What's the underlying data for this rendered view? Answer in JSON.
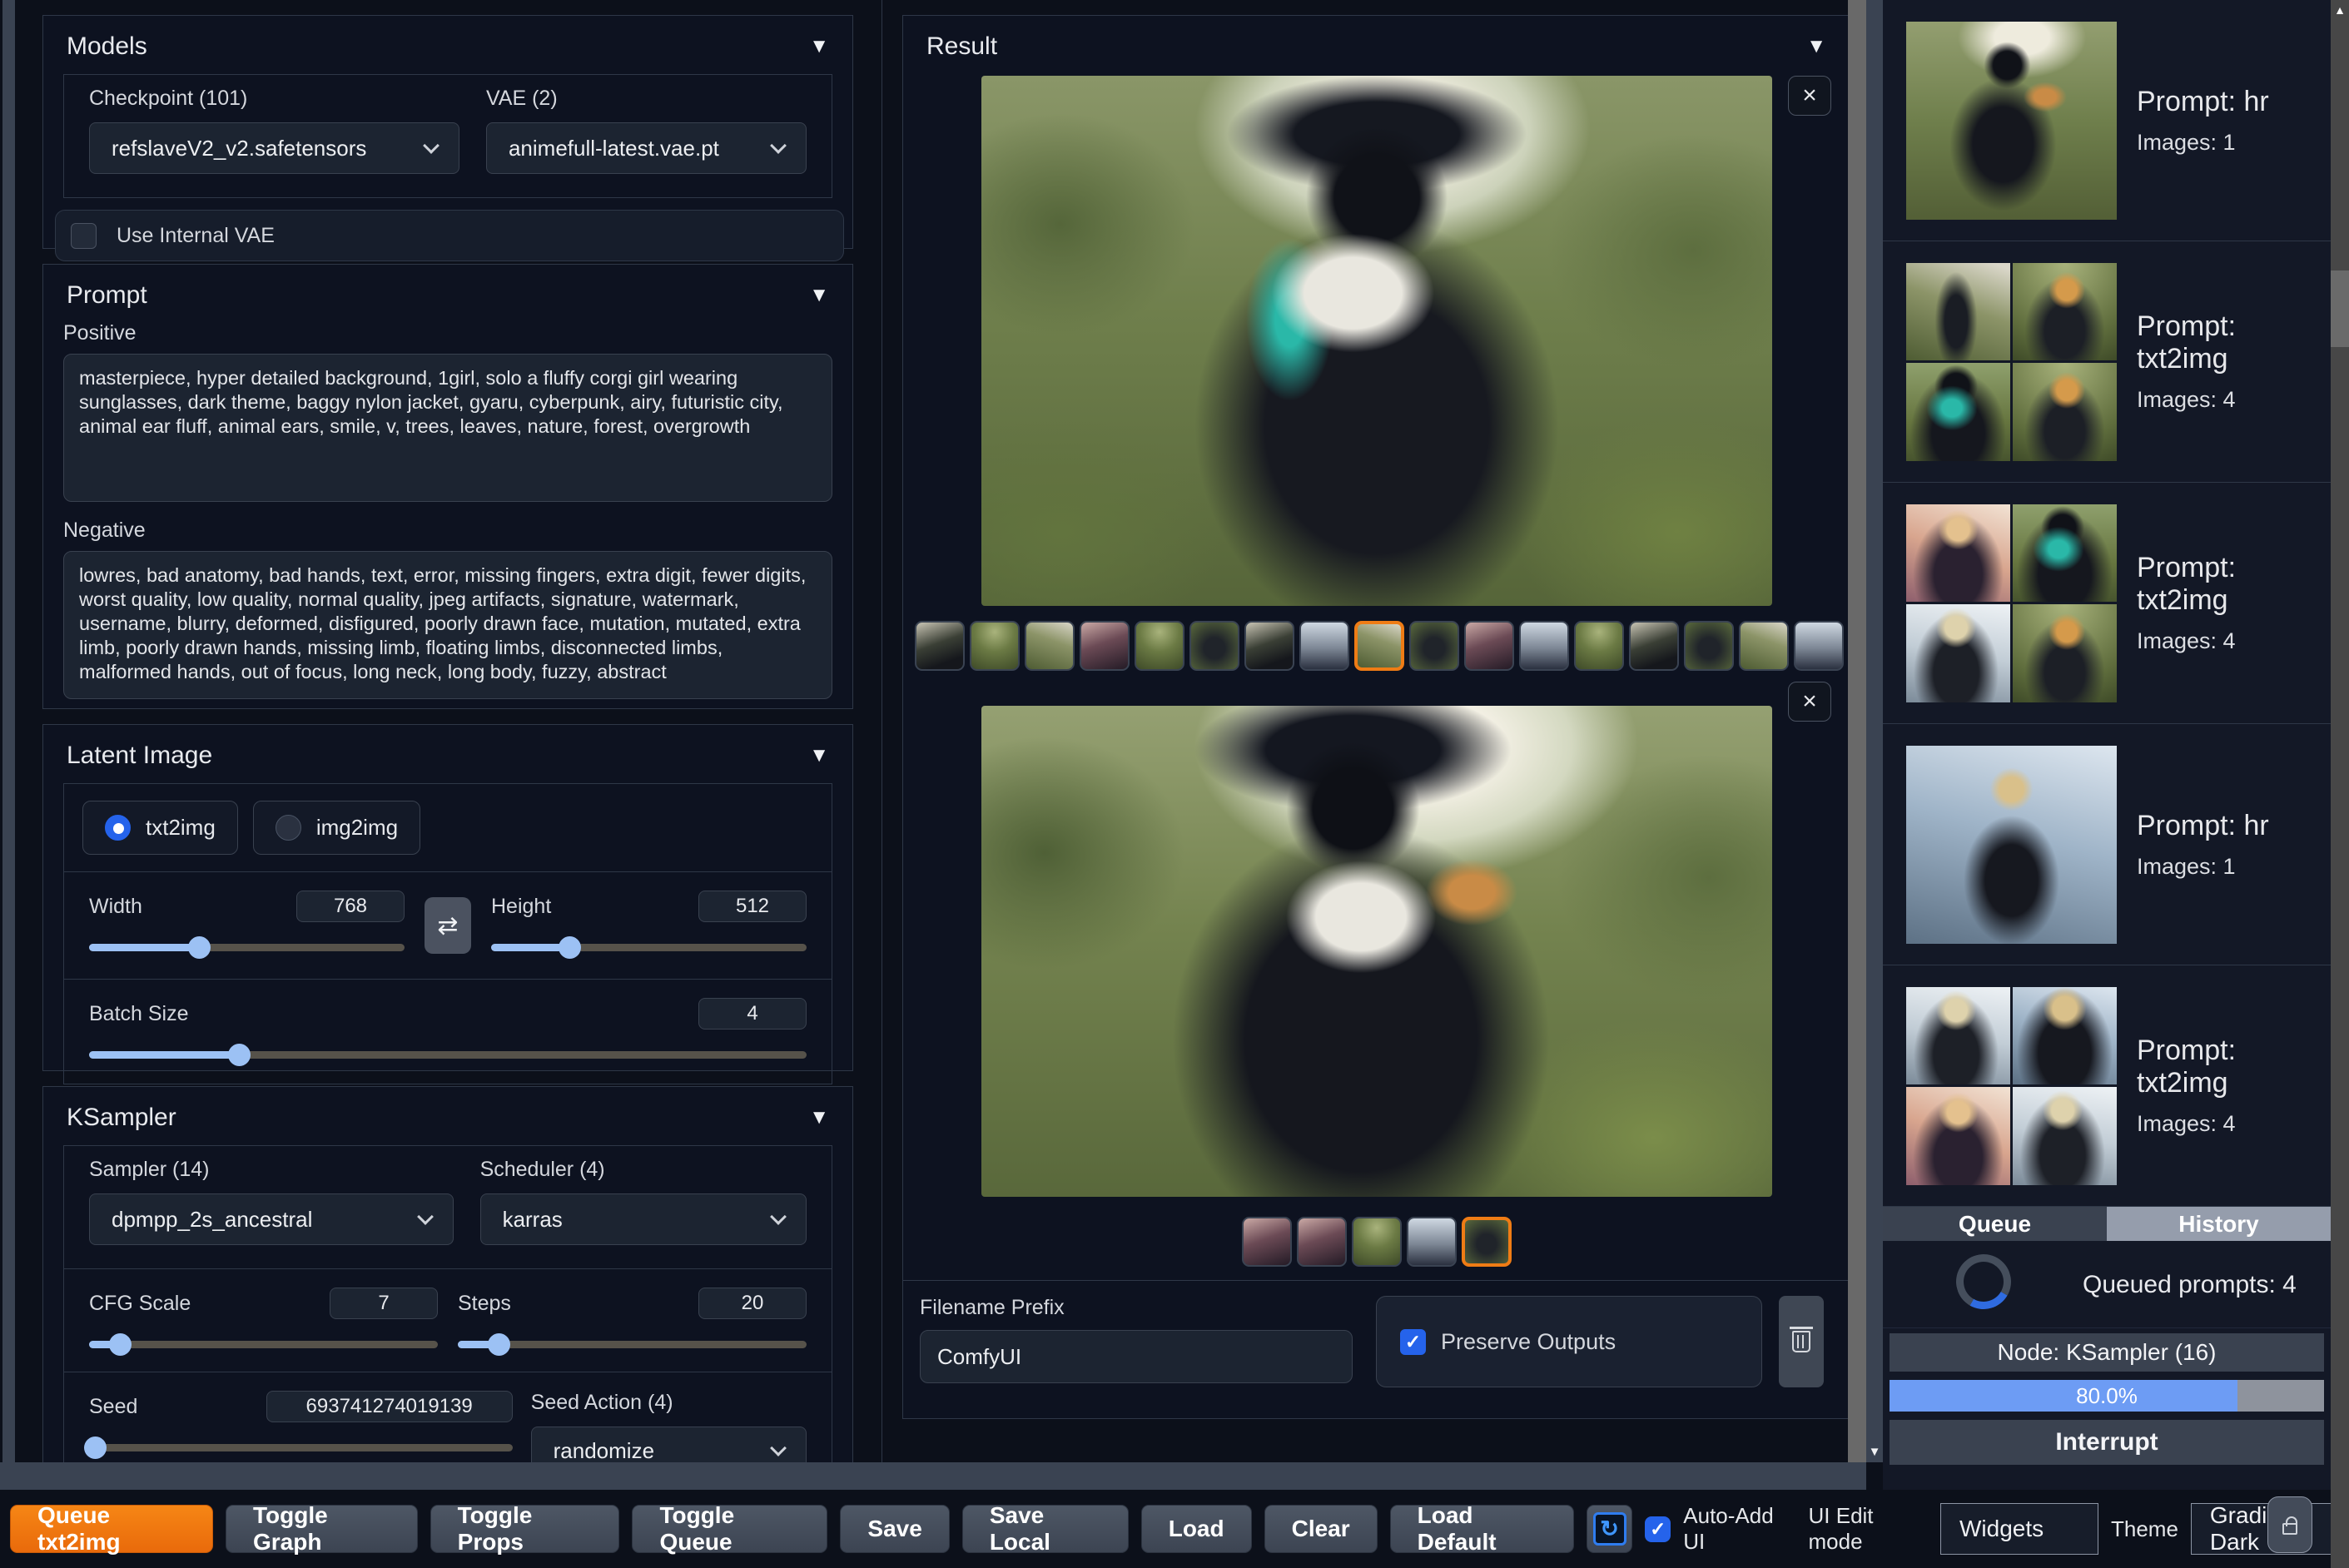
{
  "icons": {
    "collapse": "▼",
    "close": "×",
    "scroll_up": "▲",
    "scroll_down": "▼",
    "swap": "⇄",
    "refresh": "↻",
    "check": "✓"
  },
  "left_panel": {
    "models": {
      "title": "Models",
      "checkpoint_label": "Checkpoint (101)",
      "checkpoint_value": "refslaveV2_v2.safetensors",
      "vae_label": "VAE (2)",
      "vae_value": "animefull-latest.vae.pt",
      "use_internal_vae_label": "Use Internal VAE"
    },
    "prompt": {
      "title": "Prompt",
      "positive_label": "Positive",
      "positive_value": "masterpiece, hyper detailed background, 1girl, solo a fluffy corgi girl wearing sunglasses, dark theme, baggy nylon jacket, gyaru, cyberpunk, airy, futuristic city, animal ear fluff, animal ears, smile, v, trees, leaves, nature, forest, overgrowth",
      "negative_label": "Negative",
      "negative_value": "lowres, bad anatomy, bad hands, text, error, missing fingers, extra digit, fewer digits, worst quality, low quality, normal quality, jpeg artifacts, signature, watermark, username, blurry, deformed, disfigured, poorly drawn face, mutation, mutated, extra limb, poorly drawn hands, missing limb, floating limbs, disconnected limbs, malformed hands, out of focus, long neck, long body, fuzzy, abstract"
    },
    "latent": {
      "title": "Latent Image",
      "modes": [
        {
          "label": "txt2img",
          "state": "on"
        },
        {
          "label": "img2img",
          "state": "off"
        }
      ],
      "width_label": "Width",
      "width_value": "768",
      "width_fill": 35,
      "height_label": "Height",
      "height_value": "512",
      "height_fill": 25,
      "batch_label": "Batch Size",
      "batch_value": "4",
      "batch_fill": 21
    },
    "ksampler": {
      "title": "KSampler",
      "sampler_label": "Sampler (14)",
      "sampler_value": "dpmpp_2s_ancestral",
      "scheduler_label": "Scheduler (4)",
      "scheduler_value": "karras",
      "cfg_label": "CFG Scale",
      "cfg_value": "7",
      "cfg_fill": 9,
      "steps_label": "Steps",
      "steps_value": "20",
      "steps_fill": 12,
      "seed_label": "Seed",
      "seed_value": "693741274019139",
      "seed_fill": 1.5,
      "seed_action_label": "Seed Action (4)",
      "seed_action_value": "randomize"
    }
  },
  "result": {
    "title": "Result",
    "gallery1_thumbs": [
      "tv1",
      "tv2",
      "tv3",
      "tv4",
      "tv2",
      "tv5",
      "tv1",
      "tv6",
      "tv3 selected",
      "tv5",
      "tv4",
      "tv6",
      "tv2",
      "tv1",
      "tv5",
      "tv3",
      "tv6"
    ],
    "gallery2_thumbs": [
      "tv4",
      "tv4",
      "tv2",
      "tv6",
      "tv5 selected"
    ],
    "filename_prefix_label": "Filename Prefix",
    "filename_prefix_value": "ComfyUI",
    "preserve_outputs_label": "Preserve Outputs"
  },
  "history": {
    "items": [
      {
        "prompt": "Prompt: hr",
        "images": "Images: 1",
        "layout": "single",
        "cells": [
          "c-hero-forest",
          "empty",
          "empty",
          "empty"
        ]
      },
      {
        "prompt": "Prompt: txt2img",
        "images": "Images: 4",
        "layout": "grid",
        "cells": [
          "c-forest-path",
          "c-forest-orange",
          "c-forest-teal",
          "c-forest-orange"
        ]
      },
      {
        "prompt": "Prompt: txt2img",
        "images": "Images: 4",
        "layout": "grid",
        "cells": [
          "c-city-pink",
          "c-forest-teal",
          "c-city-light",
          "c-forest-orange"
        ]
      },
      {
        "prompt": "Prompt: hr",
        "images": "Images: 1",
        "layout": "single",
        "cells": [
          "c-city-blonde",
          "empty",
          "empty",
          "empty"
        ]
      },
      {
        "prompt": "Prompt: txt2img",
        "images": "Images: 4",
        "layout": "grid",
        "cells": [
          "c-city-light",
          "c-city-blonde",
          "c-city-pink",
          "c-city-light"
        ]
      }
    ]
  },
  "queue_panel": {
    "tabs": [
      {
        "label": "Queue",
        "state": "dark"
      },
      {
        "label": "History",
        "state": "light"
      }
    ],
    "queued_prompts": "Queued prompts: 4",
    "node_label": "Node: KSampler (16)",
    "progress_percent": 80,
    "progress_label": "80.0%",
    "interrupt_label": "Interrupt"
  },
  "toolbar": {
    "buttons": [
      {
        "label": "Queue txt2img",
        "kind": "primary"
      },
      {
        "label": "Toggle Graph",
        "kind": "default"
      },
      {
        "label": "Toggle Props",
        "kind": "default"
      },
      {
        "label": "Toggle Queue",
        "kind": "default"
      },
      {
        "label": "Save",
        "kind": "default"
      },
      {
        "label": "Save Local",
        "kind": "default"
      },
      {
        "label": "Load",
        "kind": "default"
      },
      {
        "label": "Clear",
        "kind": "default"
      },
      {
        "label": "Load Default",
        "kind": "default"
      }
    ],
    "auto_add_label": "Auto-Add UI",
    "ui_edit_label": "UI Edit mode",
    "widgets_value": "Widgets",
    "theme_label": "Theme",
    "theme_value": "Gradio Dark"
  }
}
